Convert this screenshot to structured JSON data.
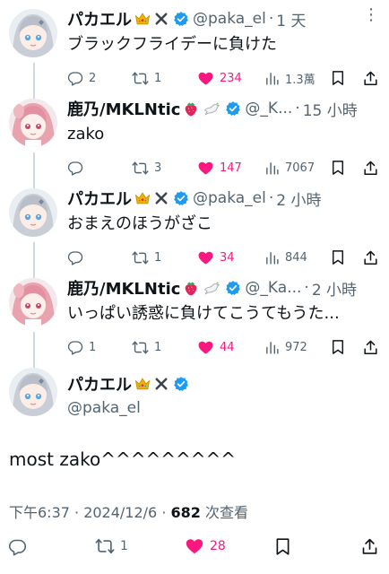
{
  "colors": {
    "verified": "#1d9bf0",
    "like": "#f91880",
    "muted": "#536471",
    "text": "#0f1419"
  },
  "replies": [
    {
      "name": "パカエル",
      "handle": "@paka_el",
      "time": "1 天",
      "text": "ブラックフライデーに負けた",
      "reply_count": "2",
      "retweet_count": "1",
      "like_count": "234",
      "view_count": "1.3萬",
      "emoji_icons": [
        "crown-icon",
        "x-mark-icon"
      ]
    },
    {
      "name": "鹿乃/MKLNtic",
      "handle": "@_K...",
      "time": "15 小時",
      "text": "zako",
      "reply_count": "",
      "retweet_count": "3",
      "like_count": "147",
      "view_count": "7067",
      "emoji_icons": [
        "strawberry-icon",
        "dove-icon"
      ]
    },
    {
      "name": "パカエル",
      "handle": "@paka_el",
      "time": "2 小時",
      "text": "おまえのほうがざこ",
      "reply_count": "",
      "retweet_count": "1",
      "like_count": "34",
      "view_count": "844",
      "emoji_icons": [
        "crown-icon",
        "x-mark-icon"
      ]
    },
    {
      "name": "鹿乃/MKLNtic",
      "handle": "@_Ka...",
      "time": "2 小時",
      "text": "いっぱい誘惑に負けてこうてもうた...",
      "reply_count": "1",
      "retweet_count": "1",
      "like_count": "44",
      "view_count": "972",
      "emoji_icons": [
        "strawberry-icon",
        "dove-icon"
      ]
    }
  ],
  "main_tweet": {
    "name": "パカエル",
    "handle": "@paka_el",
    "text": "most zako^^^^^^^^^",
    "timestamp": "下午6:37 · 2024/12/6 · ",
    "view_count": "682",
    "views_label": " 次查看",
    "retweet_count": "1",
    "like_count": "28"
  }
}
